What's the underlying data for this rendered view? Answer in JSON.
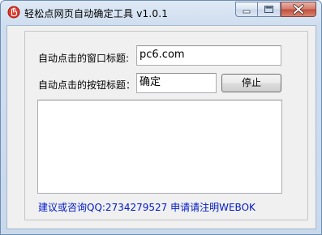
{
  "window": {
    "title": "轻松点网页自动确定工具 v1.0.1",
    "icon": "app-logo-icon",
    "controls": [
      "minimize-icon",
      "maximize-icon",
      "close-icon"
    ]
  },
  "form": {
    "window_title_label": "自动点击的窗口标题:",
    "window_title_value": "pc6.com",
    "button_title_label": "自动点击的按钮标题：",
    "button_title_value": "确定",
    "stop_button_label": "停止"
  },
  "log": {
    "text": ""
  },
  "footer": {
    "contact_text": "建议或咨询QQ:2734279527 申请请注明WEBOK"
  },
  "colors": {
    "link": "#0019c8",
    "close_button": "#c04e3b",
    "titlebar": "#cfdeef"
  }
}
